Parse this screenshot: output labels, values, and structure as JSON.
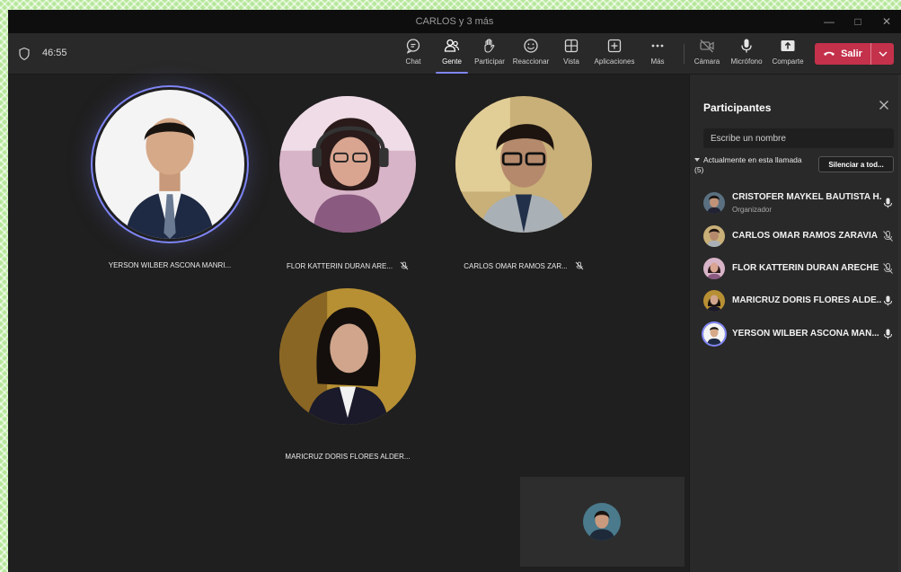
{
  "window": {
    "title": "CARLOS y 3 más"
  },
  "toolbar": {
    "timer": "46:55",
    "buttons": [
      {
        "id": "chat",
        "label": "Chat",
        "icon": "chat-icon"
      },
      {
        "id": "people",
        "label": "Gente",
        "icon": "people-icon",
        "active": true
      },
      {
        "id": "raise",
        "label": "Participar",
        "icon": "raise-hand-icon"
      },
      {
        "id": "react",
        "label": "Reaccionar",
        "icon": "smile-icon"
      },
      {
        "id": "view",
        "label": "Vista",
        "icon": "grid-icon"
      },
      {
        "id": "apps",
        "label": "Aplicaciones",
        "icon": "plus-square-icon"
      },
      {
        "id": "more",
        "label": "Más",
        "icon": "more-icon"
      },
      {
        "id": "camera",
        "label": "Cámara",
        "icon": "camera-off-icon"
      },
      {
        "id": "mic",
        "label": "Micrófono",
        "icon": "mic-icon"
      },
      {
        "id": "share",
        "label": "Comparte",
        "icon": "share-icon"
      }
    ],
    "leave_label": "Salir",
    "accent": "#7f85f5",
    "leave_color": "#c4314b"
  },
  "stage": {
    "tiles": [
      {
        "name": "YERSON WILBER ASCONA MANRI...",
        "muted": false,
        "speaking": true
      },
      {
        "name": "FLOR KATTERIN DURAN ARE...",
        "muted": true
      },
      {
        "name": "CARLOS OMAR RAMOS ZAR...",
        "muted": true
      },
      {
        "name": "MARICRUZ DORIS FLORES ALDER...",
        "muted": false
      }
    ]
  },
  "panel": {
    "title": "Participantes",
    "search_placeholder": "Escribe un nombre",
    "section_label": "Actualmente en esta llamada",
    "section_count": "(5)",
    "mute_all_label": "Silenciar a tod...",
    "participants": [
      {
        "name": "CRISTOFER MAYKEL BAUTISTA H...",
        "role": "Organizador",
        "mic": "on"
      },
      {
        "name": "CARLOS OMAR RAMOS ZARAVIA",
        "role": "",
        "mic": "off"
      },
      {
        "name": "FLOR KATTERIN DURAN ARECHE",
        "role": "",
        "mic": "off"
      },
      {
        "name": "MARICRUZ DORIS FLORES ALDE...",
        "role": "",
        "mic": "on"
      },
      {
        "name": "YERSON WILBER ASCONA MAN...",
        "role": "",
        "mic": "on"
      }
    ]
  }
}
